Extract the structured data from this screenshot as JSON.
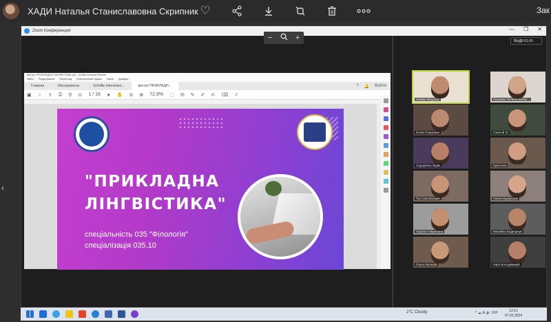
{
  "viewer": {
    "title": "ХАДИ Наталья Станиславовна Скрипник",
    "right_text": "Зак",
    "icons": [
      "heart-icon",
      "share-icon",
      "download-icon",
      "crop-icon",
      "trash-icon",
      "more-icon"
    ],
    "glyphs": [
      "♡",
      "⋖",
      "⤓",
      "⧉",
      "🗑",
      "∘∘∘"
    ]
  },
  "zoom": {
    "window_title": "Zoom Конференция",
    "toolbar": {
      "zoom_out": "−",
      "zoom_in": "+",
      "magnifier": "⚲"
    },
    "view_label": "Вид",
    "timer": "00:01:09"
  },
  "pdf": {
    "title": "виступ ПРИКЛАДНА ЛІНГВІСТИКА.pdf - Adobe Acrobat Reader",
    "menu": [
      "Файл",
      "Редагування",
      "Перегляд",
      "Електронний підпис",
      "Вікно",
      "Довідка"
    ],
    "tabs": [
      "Главная",
      "Инструменты",
      "Schrifte Intervision...",
      "виступ ПРИКЛАДН..."
    ],
    "tab_right": [
      "?",
      "🔔",
      "Войти"
    ],
    "page_indicator": "1 / 16",
    "zoom_level": "72,9%"
  },
  "slide": {
    "title_line1": "\"ПРИКЛАДНА",
    "title_line2": "ЛІНГВІСТИКА\"",
    "spec_line1": "спеціальність 035 \"Філологія\"",
    "spec_line2": "спеціалізація 035.10"
  },
  "participants": [
    {
      "name": "Natalia Skrypnyk",
      "face": "#c08a6e",
      "bg": "#e9e0d2",
      "active": true
    },
    {
      "name": "Сірченко Тетяна Олексі...",
      "face": "#d0a487",
      "bg": "#ddd6cf",
      "active": false
    },
    {
      "name": "Юлия Порасікин",
      "face": "#bb8a70",
      "bg": "#5a4a42",
      "active": false
    },
    {
      "name": "Гомоній Ю",
      "face": "#c6957a",
      "bg": "#3f4b3c",
      "active": false
    },
    {
      "name": "Сидоренко Бідім",
      "face": "#b87f66",
      "bg": "#4a3b5a",
      "active": false
    },
    {
      "name": "Кристина",
      "face": "#cf9d82",
      "bg": "#6a5a4d",
      "active": false
    },
    {
      "name": "Пустова Валерія",
      "face": "#c99377",
      "bg": "#7d6a60",
      "active": false
    },
    {
      "name": "Ганна Муравська",
      "face": "#d4a58a",
      "bg": "#8d7f7a",
      "active": false
    },
    {
      "name": "Україна Гаврильна",
      "face": "#c3906f",
      "bg": "#9c9c9c",
      "active": false
    },
    {
      "name": "Михайло Боднорчук",
      "face": "#b88567",
      "bg": "#5d5d5d",
      "active": false
    },
    {
      "name": "Ольга Валерій",
      "face": "#c89877",
      "bg": "#6f5a4e",
      "active": false
    },
    {
      "name": "Карл Володимирій",
      "face": "#b4806a",
      "bg": "#3f3f3f",
      "active": false
    }
  ],
  "taskbar": {
    "apps": [
      "#1f6fd6",
      "#3aa3e8",
      "#f0c419",
      "#e3452a",
      "#2b7cd3",
      "#4267b2",
      "#2b5797",
      "#7a3fd1"
    ],
    "weather": "2°C  Cloudy",
    "tray": "^ ☁ ⊞ 🔊 УКР",
    "time": "13:12",
    "date": "07.02.2024"
  }
}
